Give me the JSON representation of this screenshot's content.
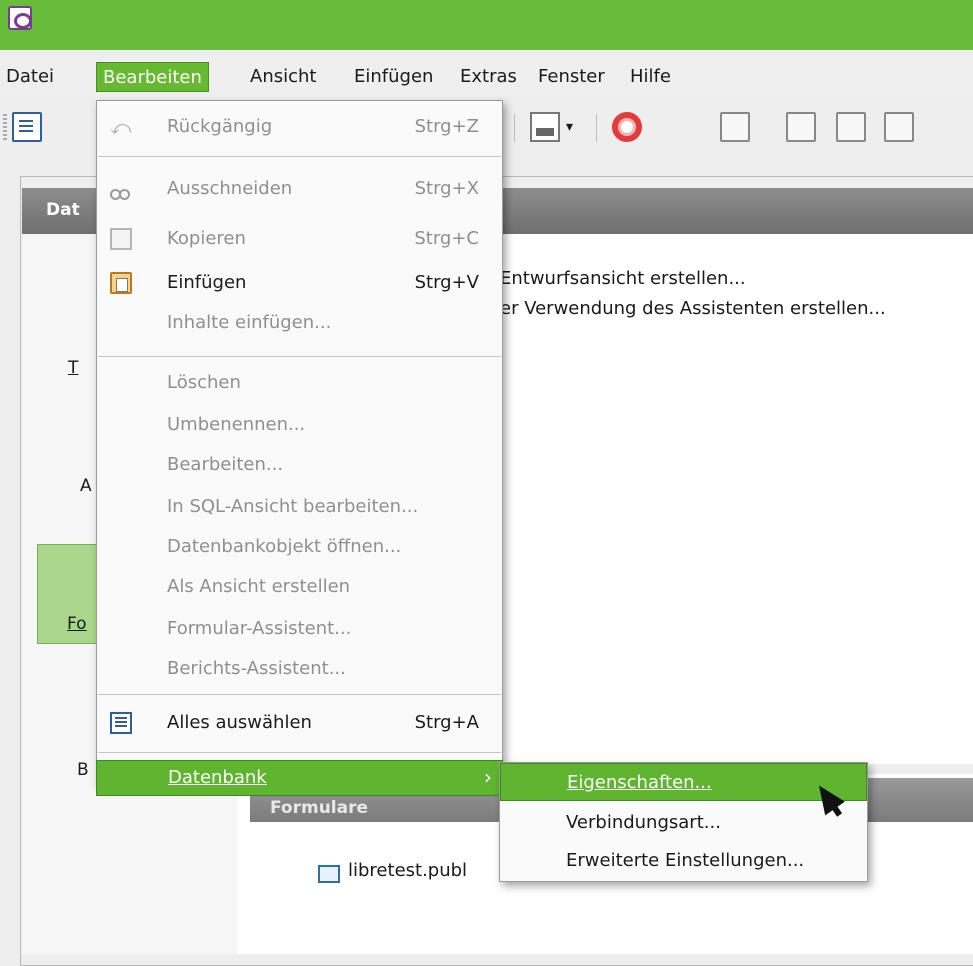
{
  "menubar": {
    "items": [
      {
        "label": "Datei",
        "key": "D"
      },
      {
        "label": "Bearbeiten",
        "key": "B"
      },
      {
        "label": "Ansicht",
        "key": "A"
      },
      {
        "label": "Einfügen",
        "key": "E"
      },
      {
        "label": "Extras",
        "key": "x"
      },
      {
        "label": "Fenster",
        "key": "s"
      },
      {
        "label": "Hilfe",
        "key": "H"
      }
    ]
  },
  "panel": {
    "header": "Dat",
    "left_labels": [
      "T",
      "A",
      "Fo",
      "B"
    ]
  },
  "tasks": [
    "Entwurfsansicht erstellen...",
    "er Verwendung des Assistenten erstellen..."
  ],
  "section": {
    "header": "Formulare",
    "item": "libretest.publ"
  },
  "edit_menu": {
    "items": [
      {
        "label": "Rückgängig",
        "accel": "Strg+Z",
        "enabled": false,
        "icon": "undo-icon"
      },
      {
        "label": "Ausschneiden",
        "accel": "Strg+X",
        "enabled": false,
        "icon": "cut-icon"
      },
      {
        "label": "Kopieren",
        "accel": "Strg+C",
        "enabled": false,
        "icon": "copy-icon"
      },
      {
        "label": "Einfügen",
        "accel": "Strg+V",
        "enabled": true,
        "icon": "paste-icon"
      },
      {
        "label": "Inhalte einfügen...",
        "accel": "",
        "enabled": false
      },
      {
        "label": "Löschen",
        "accel": "",
        "enabled": false
      },
      {
        "label": "Umbenennen...",
        "accel": "",
        "enabled": false
      },
      {
        "label": "Bearbeiten...",
        "accel": "",
        "enabled": false
      },
      {
        "label": "In SQL-Ansicht bearbeiten...",
        "accel": "",
        "enabled": false
      },
      {
        "label": "Datenbankobjekt öffnen...",
        "accel": "",
        "enabled": false
      },
      {
        "label": "Als Ansicht erstellen",
        "accel": "",
        "enabled": false
      },
      {
        "label": "Formular-Assistent...",
        "accel": "",
        "enabled": false
      },
      {
        "label": "Berichts-Assistent...",
        "accel": "",
        "enabled": false
      },
      {
        "label": "Alles auswählen",
        "accel": "Strg+A",
        "enabled": true,
        "icon": "select-all-icon"
      },
      {
        "label": "Datenbank",
        "accel": "",
        "enabled": true,
        "submenu": true
      }
    ]
  },
  "submenu": {
    "items": [
      {
        "label": "Eigenschaften..."
      },
      {
        "label": "Verbindungsart..."
      },
      {
        "label": "Erweiterte Einstellungen..."
      }
    ]
  },
  "colors": {
    "accent": "#67bd3a",
    "highlight": "#5fb52f"
  }
}
